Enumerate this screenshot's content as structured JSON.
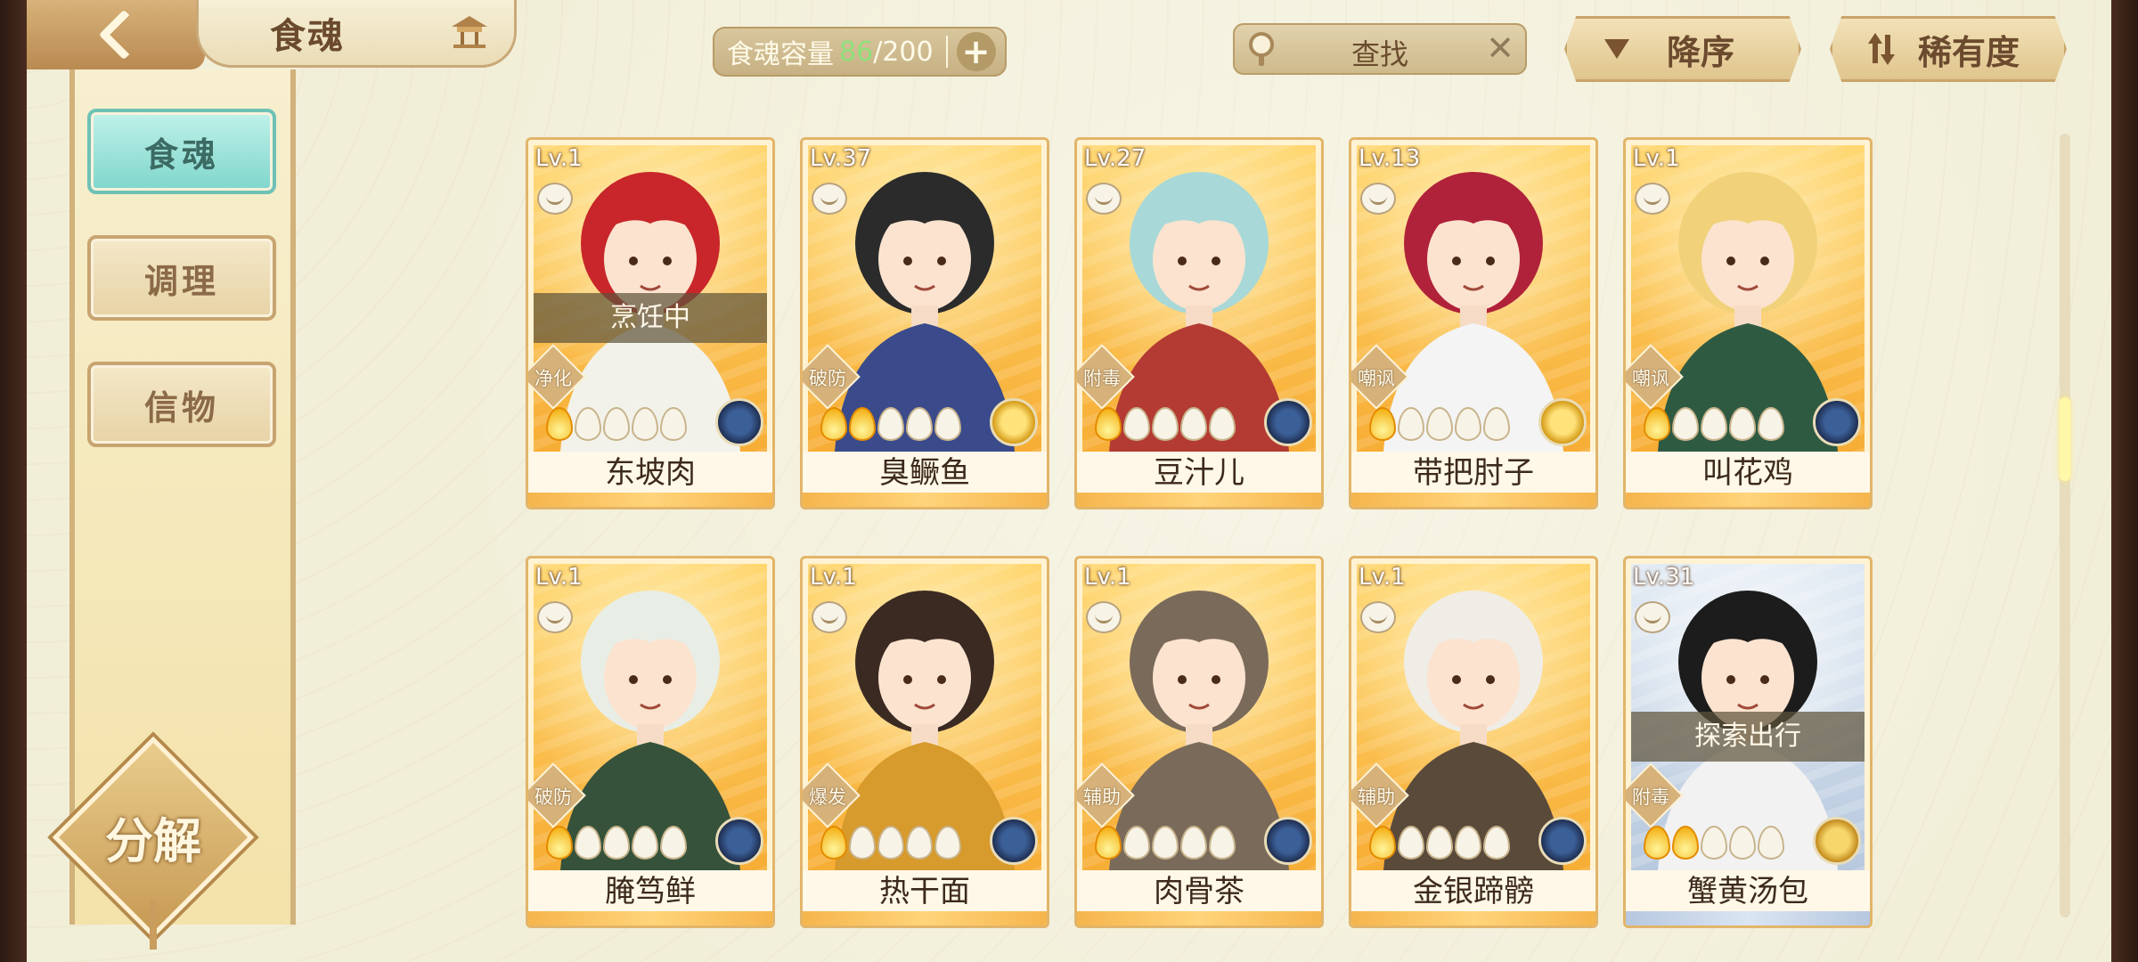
{
  "header": {
    "title": "食魂",
    "capacity_label": "食魂容量",
    "capacity_current": "86",
    "capacity_separator": "/",
    "capacity_max": "200",
    "add_label": "+",
    "search_placeholder": "查找",
    "clear_label": "✕",
    "sort_order_label": "降序",
    "sort_key_label": "稀有度"
  },
  "sidebar": {
    "items": [
      {
        "label": "食魂",
        "active": true
      },
      {
        "label": "调理",
        "active": false
      },
      {
        "label": "信物",
        "active": false
      }
    ],
    "decompose_label": "分解"
  },
  "cards": [
    {
      "level": "Lv.1",
      "name": "东坡肉",
      "role": "净化",
      "status": "烹饪中",
      "stars": 1,
      "element": "blue-flower",
      "frame": "gold"
    },
    {
      "level": "Lv.37",
      "name": "臭鳜鱼",
      "role": "破防",
      "status": "",
      "stars": 2,
      "element": "gold-flower",
      "frame": "gold"
    },
    {
      "level": "Lv.27",
      "name": "豆汁儿",
      "role": "附毒",
      "status": "",
      "stars": 1,
      "element": "blue-flower",
      "frame": "gold"
    },
    {
      "level": "Lv.13",
      "name": "带把肘子",
      "role": "嘲讽",
      "status": "",
      "stars": 1,
      "element": "gold-flower",
      "frame": "gold"
    },
    {
      "level": "Lv.1",
      "name": "叫花鸡",
      "role": "嘲讽",
      "status": "",
      "stars": 1,
      "element": "blue-flower",
      "frame": "gold"
    },
    {
      "level": "Lv.1",
      "name": "腌笃鲜",
      "role": "破防",
      "status": "",
      "stars": 1,
      "element": "blue-flower",
      "frame": "gold"
    },
    {
      "level": "Lv.1",
      "name": "热干面",
      "role": "爆发",
      "status": "",
      "stars": 1,
      "element": "blue-flower",
      "frame": "gold"
    },
    {
      "level": "Lv.1",
      "name": "肉骨茶",
      "role": "辅助",
      "status": "",
      "stars": 1,
      "element": "blue-flower",
      "frame": "gold"
    },
    {
      "level": "Lv.1",
      "name": "金银蹄髈",
      "role": "辅助",
      "status": "",
      "stars": 1,
      "element": "blue-flower",
      "frame": "gold"
    },
    {
      "level": "Lv.31",
      "name": "蟹黄汤包",
      "role": "附毒",
      "status": "探索出行",
      "stars": 2,
      "element": "sun-flower",
      "frame": "blue"
    }
  ],
  "colors": {
    "accent_teal": "#7fd6cb",
    "gold_frame": "#e2b56a",
    "capacity_current": "#8ee07a"
  },
  "icons": {
    "back": "chevron-left-icon",
    "title_decor": "pavilion-icon",
    "search": "magnifier-icon",
    "clear": "close-icon",
    "sort_order": "triangle-down-icon",
    "sort_key": "sort-arrows-icon"
  }
}
